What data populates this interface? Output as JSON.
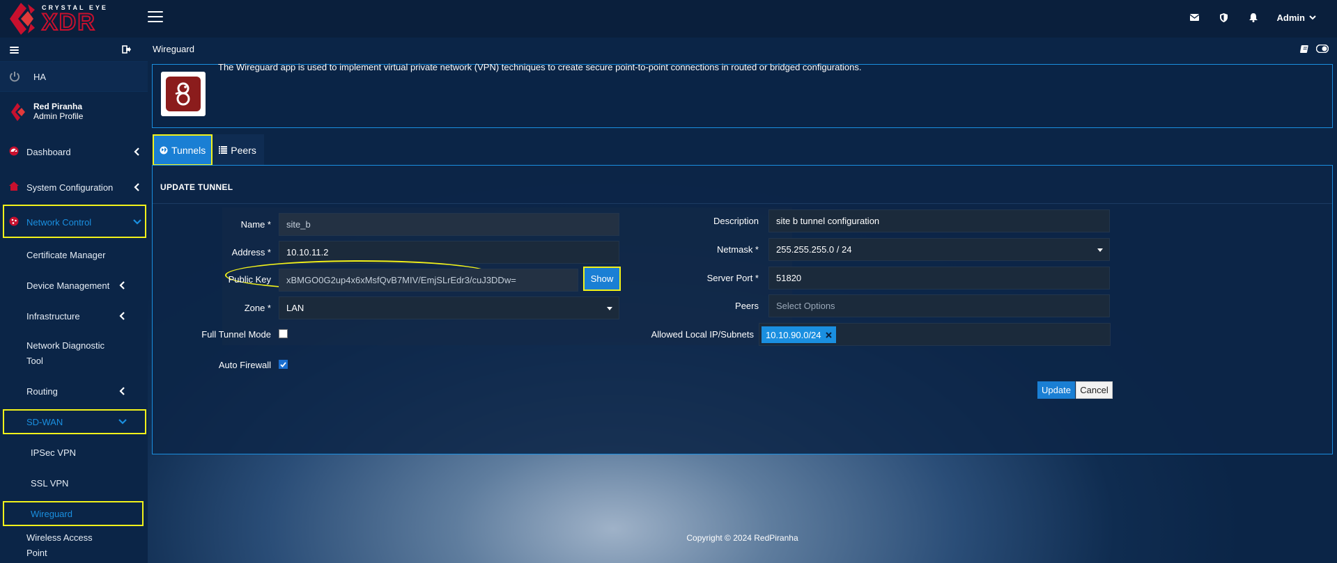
{
  "brand": {
    "line1": "CRYSTAL EYE",
    "line2": "XDR"
  },
  "topbar": {
    "user": "Admin",
    "icons": [
      "envelope-icon",
      "shield-icon",
      "bell-icon"
    ]
  },
  "sidebar": {
    "ha": "HA",
    "profile": {
      "name": "Red Piranha",
      "role": "Admin Profile"
    },
    "items": [
      {
        "label": "Dashboard"
      },
      {
        "label": "System Configuration"
      },
      {
        "label": "Network Control"
      }
    ],
    "network_children": [
      {
        "label": "Certificate Manager"
      },
      {
        "label": "Device Management"
      },
      {
        "label": "Infrastructure"
      },
      {
        "label": "Network Diagnostic Tool",
        "line1": "Network Diagnostic",
        "line2": "Tool"
      },
      {
        "label": "Routing"
      },
      {
        "label": "SD-WAN"
      }
    ],
    "sdwan_children": [
      {
        "label": "IPSec VPN"
      },
      {
        "label": "SSL VPN"
      },
      {
        "label": "Wireguard"
      }
    ],
    "tail": {
      "line1": "Wireless Access",
      "line2": "Point"
    },
    "accent_color": "#1a8fe0",
    "highlight_color": "#f2f21a"
  },
  "page": {
    "title": "Wireguard",
    "description": "The Wireguard app is used to implement virtual private network (VPN) techniques to create secure point-to-point connections in routed or bridged configurations.",
    "tabs": [
      {
        "label": "Tunnels",
        "active": true
      },
      {
        "label": "Peers",
        "active": false
      }
    ],
    "panel_title": "UPDATE TUNNEL",
    "form": {
      "name_label": "Name *",
      "name_value": "site_b",
      "address_label": "Address *",
      "address_value": "10.10.11.2",
      "pubkey_label": "Public Key",
      "pubkey_value": "xBMGO0G2up4x6xMsfQvB7MIV/EmjSLrEdr3/cuJ3DDw=",
      "show_button": "Show",
      "zone_label": "Zone *",
      "zone_value": "LAN",
      "full_tunnel_label": "Full Tunnel Mode",
      "full_tunnel_checked": false,
      "auto_firewall_label": "Auto Firewall",
      "auto_firewall_checked": true,
      "description_label": "Description",
      "description_value": "site b tunnel configuration",
      "netmask_label": "Netmask *",
      "netmask_value": "255.255.255.0 / 24",
      "server_port_label": "Server Port *",
      "server_port_value": "51820",
      "peers_label": "Peers",
      "peers_placeholder": "Select Options",
      "allowed_label": "Allowed Local IP/Subnets",
      "allowed_tags": [
        "10.10.90.0/24"
      ]
    },
    "update_button": "Update",
    "cancel_button": "Cancel"
  },
  "footer": "Copyright © 2024 RedPiranha"
}
